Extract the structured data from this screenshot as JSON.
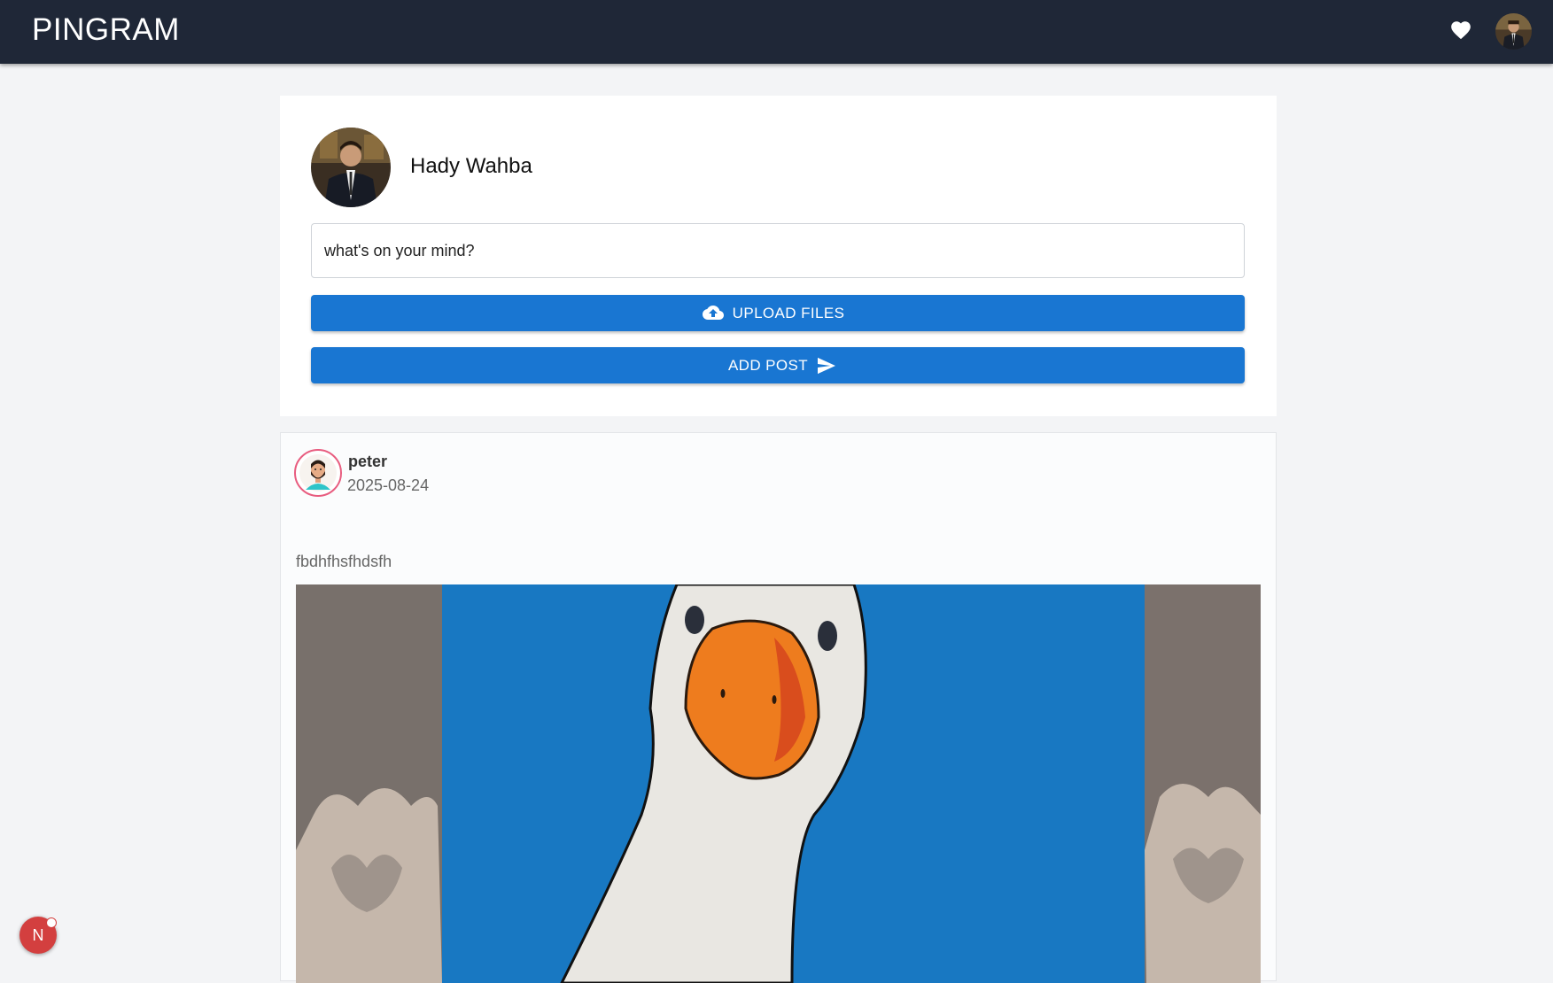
{
  "navbar": {
    "brand": "PINGRAM",
    "favorites_icon": "heart-icon",
    "profile_icon": "user-avatar"
  },
  "composer": {
    "user_name": "Hady Wahba",
    "input_placeholder": "what's on your mind?",
    "upload_label": "UPLOAD FILES",
    "upload_icon": "cloud-upload-icon",
    "add_post_label": "ADD POST",
    "add_post_icon": "send-icon"
  },
  "post": {
    "author": "peter",
    "date": "2025-08-24",
    "text": "fbdhfhsfhdsfh",
    "image_icon": "goose-painting"
  },
  "dev_badge": {
    "letter": "N"
  },
  "colors": {
    "navbar": "#1f2737",
    "primary_button": "#1976d2",
    "page_background": "#f3f4f6",
    "badge": "#d33f3f"
  }
}
